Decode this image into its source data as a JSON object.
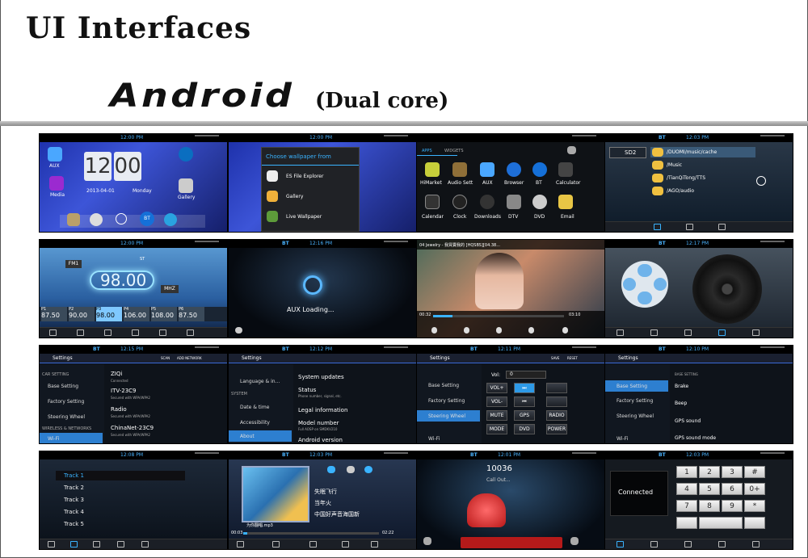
{
  "header": {
    "title": "UI  Interfaces",
    "os": "Android",
    "cpu": "(Dual core)"
  },
  "status_bar": {
    "bt": "BT",
    "times": [
      "12:00 PM",
      "12:00 PM",
      "",
      "12:03 PM",
      "12:00 PM",
      "12:16 PM",
      "",
      "12:17 PM",
      "12:15 PM",
      "12:12 PM",
      "12:11 PM",
      "12:10 PM",
      "12:08 PM",
      "12:03 PM",
      "12:01 PM",
      "12:03 PM"
    ]
  },
  "home": {
    "clock": "12:00",
    "clock_digits": [
      "12",
      "00"
    ],
    "date": "2013-04-01",
    "day": "Monday",
    "apps": [
      "AUX",
      "Media",
      "Gallery",
      "BT"
    ]
  },
  "wallpaper": {
    "title": "Choose wallpaper from",
    "options": [
      "ES File Explorer",
      "Gallery",
      "Live Wallpaper"
    ]
  },
  "apps_drawer": {
    "tabs": [
      "APPS",
      "WIDGETS"
    ],
    "row1": [
      "HiMarket",
      "Audio Sett",
      "AUX",
      "Browser",
      "BT",
      "Calculator"
    ],
    "row2": [
      "Calendar",
      "Clock",
      "Downloads",
      "DTV",
      "DVD",
      "Email"
    ]
  },
  "files": {
    "drive": "SD2",
    "paths": [
      "/DUOMI/music/cache",
      "/Music",
      "/TianQiTong/TTS",
      "/AGO/audio"
    ]
  },
  "radio": {
    "band": "FM1",
    "st": "ST",
    "freq": "98.00",
    "unit": "MHZ",
    "presets_labels": [
      "P1",
      "P2",
      "P3",
      "P4",
      "P5",
      "P6"
    ],
    "presets": [
      "87.50",
      "90.00",
      "98.00",
      "106.00",
      "108.00",
      "87.50"
    ]
  },
  "aux": {
    "text": "AUX Loading..."
  },
  "video": {
    "title": "04 Jewelry - 我買賣我的 [HQSBS][04.38...",
    "time_start": "00:32",
    "time_end": "03:10"
  },
  "settings_wifi": {
    "title": "Settings",
    "actions": [
      "SCAN",
      "ADD NETWORK"
    ],
    "section": "CAR SETTING",
    "side": [
      "Base Setting",
      "Factory Setting",
      "Steering Wheel",
      "Wi-Fi"
    ],
    "section2": "WIRELESS & NETWORKS",
    "networks": [
      {
        "name": "ZIQi",
        "sub": "Connected"
      },
      {
        "name": "ITV-23C9",
        "sub": "Secured with WPA/WPA2"
      },
      {
        "name": "Radio",
        "sub": "Secured with WPA/WPA2"
      },
      {
        "name": "ChinaNet-23C9",
        "sub": "Secured with WPA/WPA2"
      }
    ]
  },
  "settings_about": {
    "title": "Settings",
    "side": [
      "Language & in...",
      "SYSTEM",
      "Date & time",
      "Accessibility",
      "About"
    ],
    "items": [
      {
        "name": "System updates",
        "sub": ""
      },
      {
        "name": "Status",
        "sub": "Phone number, signal, etc."
      },
      {
        "name": "Legal information",
        "sub": ""
      },
      {
        "name": "Model number",
        "sub": "Full AOSP on SMDKV210"
      },
      {
        "name": "Android version",
        "sub": ""
      }
    ]
  },
  "settings_wheel": {
    "title": "Settings",
    "actions": [
      "SAVE",
      "RESET"
    ],
    "side": [
      "Base Setting",
      "Factory Setting",
      "Steering Wheel",
      "Wi-Fi"
    ],
    "vol_label": "Vol:",
    "vol_value": "0",
    "keys": [
      "VOL+",
      "⏭",
      "",
      "VOL-",
      "⏮",
      "",
      "MUTE",
      "GPS",
      "RADIO",
      "MODE",
      "DVD",
      "POWER"
    ]
  },
  "settings_base": {
    "title": "Settings",
    "section": "BASE SETTING",
    "side": [
      "Base Setting",
      "Factory Setting",
      "Steering Wheel",
      "Wi-Fi"
    ],
    "items": [
      "Brake",
      "Beep",
      "GPS sound",
      "GPS sound mode"
    ]
  },
  "tracks": [
    "Track 1",
    "Track 2",
    "Track 3",
    "Track 4",
    "Track 5"
  ],
  "music": {
    "tracks": [
      "失眠飞行",
      "当年火",
      "中国好声音海国新"
    ],
    "file": "为你翻唱.mp3",
    "time_start": "00:03",
    "time_end": "02:22"
  },
  "call": {
    "number": "10036",
    "status": "Call Out..."
  },
  "dialer": {
    "status": "Connected",
    "keys": [
      "1",
      "2",
      "3",
      "#",
      "4",
      "5",
      "6",
      "0+",
      "7",
      "8",
      "9",
      "*"
    ]
  },
  "colors": {
    "accent": "#2d7fd0",
    "statusbar_text": "#4ab3ff"
  }
}
